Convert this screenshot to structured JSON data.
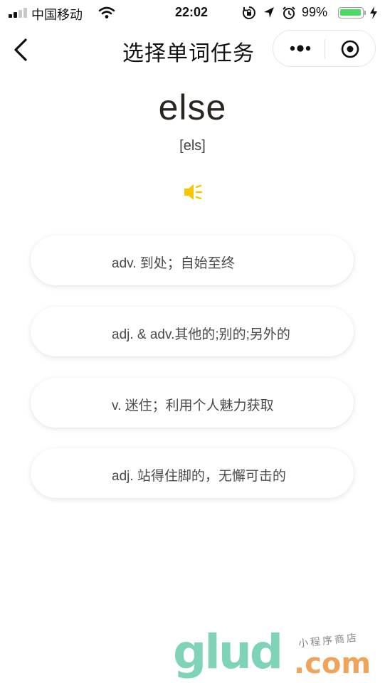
{
  "status_bar": {
    "carrier": "中国移动",
    "time": "22:02",
    "battery_percent": "99%",
    "battery_level": 0.99,
    "icons": [
      "signal-icon",
      "wifi-icon",
      "orientation-lock-icon",
      "location-icon",
      "alarm-icon",
      "battery-icon",
      "charging-bolt-icon"
    ]
  },
  "nav": {
    "title": "选择单词任务",
    "back_icon": "chevron-left-icon",
    "more_icon": "more-dots-icon",
    "close_icon": "target-circle-icon"
  },
  "word": {
    "text": "else",
    "phonetic": "[els]",
    "audio_icon": "speaker-icon",
    "audio_color": "#f6c700"
  },
  "options": [
    {
      "label": "adv. 到处；自始至终"
    },
    {
      "label": "adj. & adv.其他的;别的;另外的"
    },
    {
      "label": "v. 迷住；利用个人魅力获取"
    },
    {
      "label": "adj. 站得住脚的，无懈可击的"
    }
  ],
  "watermark": {
    "main": "glud",
    "suffix": ".com",
    "tagline": "小程序商店"
  }
}
